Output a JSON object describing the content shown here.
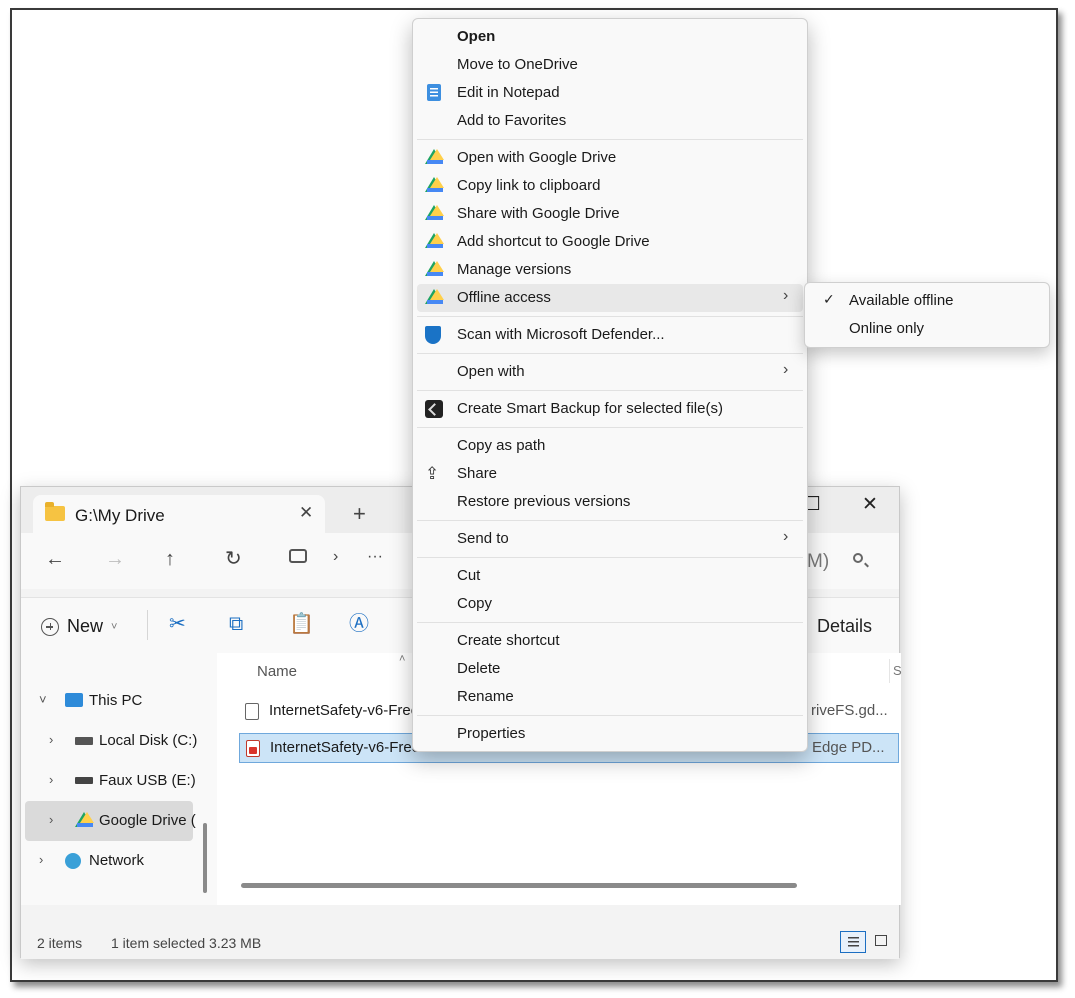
{
  "explorer": {
    "tab_title": "G:\\My Drive",
    "tab_close": "✕",
    "new_tab": "+",
    "window_close": "✕",
    "search_fragment": "M)",
    "new_label": "New",
    "details_label": "Details",
    "column_name": "Name",
    "column_s": "S",
    "sidebar": {
      "this_pc": "This PC",
      "local_disk": "Local Disk (C:)",
      "faux_usb": "Faux USB (E:)",
      "google_drive": "Google Drive (",
      "network": "Network"
    },
    "files": [
      {
        "name": "InternetSafety-v6-Free",
        "type": "riveFS.gd..."
      },
      {
        "name": "InternetSafety-v6-Free",
        "type": "Edge PD..."
      }
    ],
    "status": {
      "items": "2 items",
      "selected": "1 item selected  3.23 MB"
    }
  },
  "context_menu": {
    "open": "Open",
    "move_onedrive": "Move to OneDrive",
    "edit_notepad": "Edit in Notepad",
    "add_favorites": "Add to Favorites",
    "open_gdrive": "Open with Google Drive",
    "copy_link": "Copy link to clipboard",
    "share_gdrive": "Share with Google Drive",
    "add_shortcut_gdrive": "Add shortcut to Google Drive",
    "manage_versions": "Manage versions",
    "offline_access": "Offline access",
    "scan_defender": "Scan with Microsoft Defender...",
    "open_with": "Open with",
    "smart_backup": "Create Smart Backup for selected file(s)",
    "copy_as_path": "Copy as path",
    "share": "Share",
    "restore_versions": "Restore previous versions",
    "send_to": "Send to",
    "cut": "Cut",
    "copy": "Copy",
    "create_shortcut": "Create shortcut",
    "delete": "Delete",
    "rename": "Rename",
    "properties": "Properties"
  },
  "submenu": {
    "available_offline": "Available offline",
    "online_only": "Online only",
    "checked_item": "Available offline"
  },
  "colors": {
    "selection": "#cce4f7",
    "accent": "#1b6ec2",
    "gdrive_green": "#1fa463",
    "gdrive_yellow": "#ffd04b",
    "gdrive_blue": "#4688f4"
  }
}
